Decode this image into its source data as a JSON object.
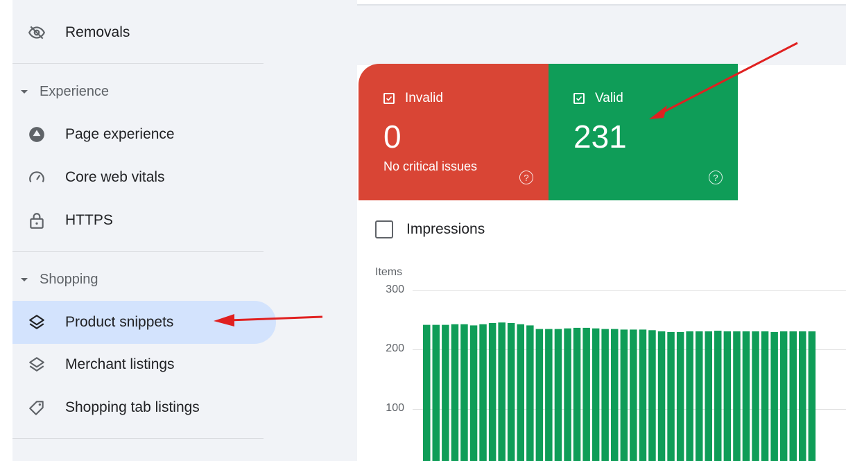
{
  "sidebar": {
    "items": [
      {
        "label": "Removals",
        "icon": "eye-off-icon"
      },
      {
        "label": "Page experience",
        "icon": "page-experience-icon"
      },
      {
        "label": "Core web vitals",
        "icon": "speedometer-icon"
      },
      {
        "label": "HTTPS",
        "icon": "lock-icon"
      },
      {
        "label": "Product snippets",
        "icon": "layers-icon",
        "active": true
      },
      {
        "label": "Merchant listings",
        "icon": "layers-icon"
      },
      {
        "label": "Shopping tab listings",
        "icon": "tag-icon"
      }
    ],
    "sections": [
      {
        "label": "Experience"
      },
      {
        "label": "Shopping"
      }
    ]
  },
  "summary": {
    "invalid": {
      "label": "Invalid",
      "value": "0",
      "subtext": "No critical issues",
      "color": "#d94535"
    },
    "valid": {
      "label": "Valid",
      "value": "231",
      "color": "#0f9d58"
    }
  },
  "impressions_label": "Impressions",
  "chart_data": {
    "type": "bar",
    "ylabel": "Items",
    "ylim": [
      0,
      300
    ],
    "yticks": [
      "300",
      "200",
      "100"
    ],
    "color": "#0f9d58",
    "values": [
      242,
      242,
      242,
      243,
      243,
      241,
      243,
      245,
      246,
      245,
      243,
      241,
      235,
      235,
      235,
      236,
      237,
      237,
      236,
      235,
      235,
      234,
      234,
      234,
      233,
      231,
      230,
      230,
      231,
      231,
      231,
      232,
      231,
      231,
      231,
      231,
      231,
      230,
      231,
      231,
      231,
      231
    ]
  },
  "annotations": {
    "arrow_color": "#e02020"
  }
}
